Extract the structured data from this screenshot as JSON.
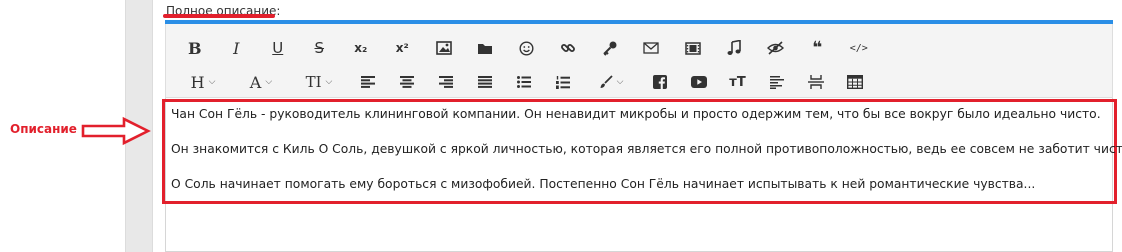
{
  "field": {
    "label": "Полное описание:"
  },
  "annotation": {
    "label": "Описание",
    "color": "#e2202c"
  },
  "toolbar": {
    "row1": [
      "bold-icon",
      "italic-icon",
      "underline-icon",
      "strikethrough-icon",
      "subscript-icon",
      "superscript-icon",
      "image-icon",
      "folder-icon",
      "emoji-icon",
      "link-icon",
      "key-icon",
      "email-icon",
      "video-icon",
      "music-icon",
      "hidden-icon",
      "quote-icon",
      "code-icon"
    ],
    "row2": [
      "heading-dropdown",
      "font-size-dropdown",
      "text-style-dropdown",
      "align-left-icon",
      "align-center-icon",
      "align-right-icon",
      "align-justify-icon",
      "bullet-list-icon",
      "numbered-list-icon",
      "color-picker-dropdown",
      "facebook-icon",
      "youtube-icon",
      "text-size-icon",
      "paragraph-format-icon",
      "page-break-icon",
      "table-icon"
    ],
    "bold": "B",
    "italic": "I",
    "underline": "U",
    "strike": "S",
    "sub": "x₂",
    "sup": "x²",
    "quote": "❝",
    "code": "</>",
    "heading": "H",
    "font": "A",
    "textstyle": "TI",
    "textsize": "ᴛT"
  },
  "content": {
    "paragraphs": [
      "Чан Сон Гёль  - руководитель клининговой компании. Он ненавидит микробы и просто одержим тем, что бы все вокруг было идеально чисто.",
      "Он знакомится с Киль О Соль, девушкой с яркой личностью, которая является его полной противоположностью, ведь ее совсем не заботит чистота.",
      "О Соль начинает помогать ему бороться с мизофобией. Постепенно Сон Гёль начинает испытывать к ней романтические чувства..."
    ]
  },
  "colors": {
    "accent_blue": "#2a8ee6",
    "highlight_red": "#e2202c"
  }
}
